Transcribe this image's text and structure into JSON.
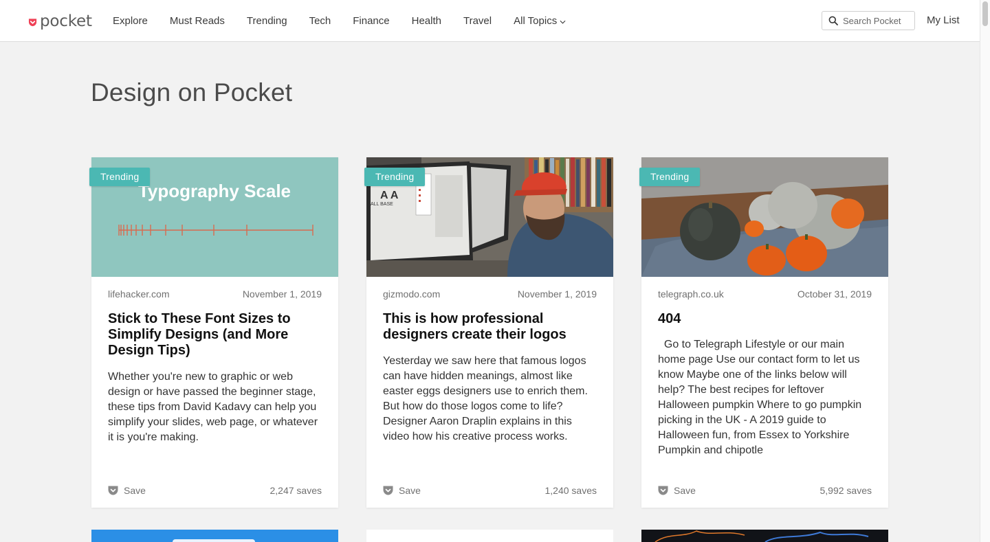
{
  "header": {
    "logo_text": "pocket",
    "nav": [
      "Explore",
      "Must Reads",
      "Trending",
      "Tech",
      "Finance",
      "Health",
      "Travel"
    ],
    "all_topics": "All Topics",
    "search_placeholder": "Search Pocket",
    "my_list": "My List"
  },
  "page_title": "Design on Pocket",
  "colors": {
    "brand_red": "#ef4056",
    "badge_teal": "#4bb8b3",
    "peek_blue": "#2b8fe6"
  },
  "cards": [
    {
      "badge": "Trending",
      "image_text": "Typography Scale",
      "source": "lifehacker.com",
      "date": "November 1, 2019",
      "title": "Stick to These Font Sizes to Simplify Designs (and More Design Tips)",
      "excerpt": "Whether you're new to graphic or web design or have passed the beginner stage, these tips from David Kadavy can help you simplify your slides, web page, or whatever it is you're making.",
      "save_label": "Save",
      "saves": "2,247 saves"
    },
    {
      "badge": "Trending",
      "source": "gizmodo.com",
      "date": "November 1, 2019",
      "title": "This is how professional designers create their logos",
      "excerpt": "Yesterday we saw here that famous logos can have hidden meanings, almost like easter eggs designers use to enrich them. But how do those logos come to life? Designer Aaron Draplin explains in this video how his creative process works.",
      "save_label": "Save",
      "saves": "1,240 saves"
    },
    {
      "badge": "Trending",
      "source": "telegraph.co.uk",
      "date": "October 31, 2019",
      "title": "404",
      "excerpt": "  Go to Telegraph Lifestyle or our main home page Use our contact form to let us know Maybe one of the links below will help? The best recipes for leftover Halloween pumpkin Where to go pumpkin picking in the UK - A 2019 guide to Halloween fun, from Essex to Yorkshire Pumpkin and chipotle",
      "save_label": "Save",
      "saves": "5,992 saves"
    }
  ]
}
